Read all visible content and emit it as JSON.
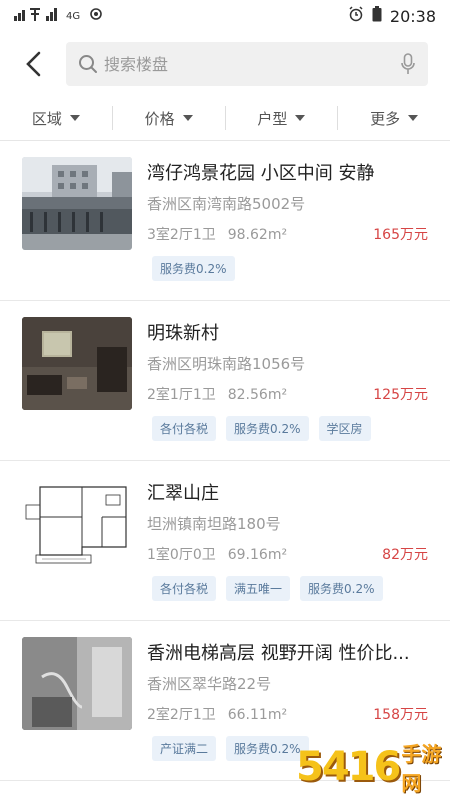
{
  "status_bar": {
    "carrier_icons": "signal-icons",
    "network": "4G",
    "time": "20:38"
  },
  "search": {
    "placeholder": "搜索楼盘"
  },
  "filters": [
    {
      "label": "区域"
    },
    {
      "label": "价格"
    },
    {
      "label": "户型"
    },
    {
      "label": "更多"
    }
  ],
  "listings": [
    {
      "title": "湾仔鸿景花园  小区中间 安静",
      "address": "香洲区南湾南路5002号",
      "layout": "3室2厅1卫",
      "area": "98.62m²",
      "price": "165万元",
      "tags": [
        "服务费0.2%"
      ]
    },
    {
      "title": "明珠新村",
      "address": "香洲区明珠南路1056号",
      "layout": "2室1厅1卫",
      "area": "82.56m²",
      "price": "125万元",
      "tags": [
        "各付各税",
        "服务费0.2%",
        "学区房"
      ]
    },
    {
      "title": "汇翠山庄",
      "address": "坦洲镇南坦路180号",
      "layout": "1室0厅0卫",
      "area": "69.16m²",
      "price": "82万元",
      "tags": [
        "各付各税",
        "满五唯一",
        "服务费0.2%"
      ]
    },
    {
      "title": "香洲电梯高层 视野开阔 性价比...",
      "address": "香洲区翠华路22号",
      "layout": "2室2厅1卫",
      "area": "66.11m²",
      "price": "158万元",
      "tags": [
        "产证满二",
        "服务费0.2%"
      ]
    }
  ],
  "watermark": {
    "number": "5416",
    "text": "手游网"
  }
}
